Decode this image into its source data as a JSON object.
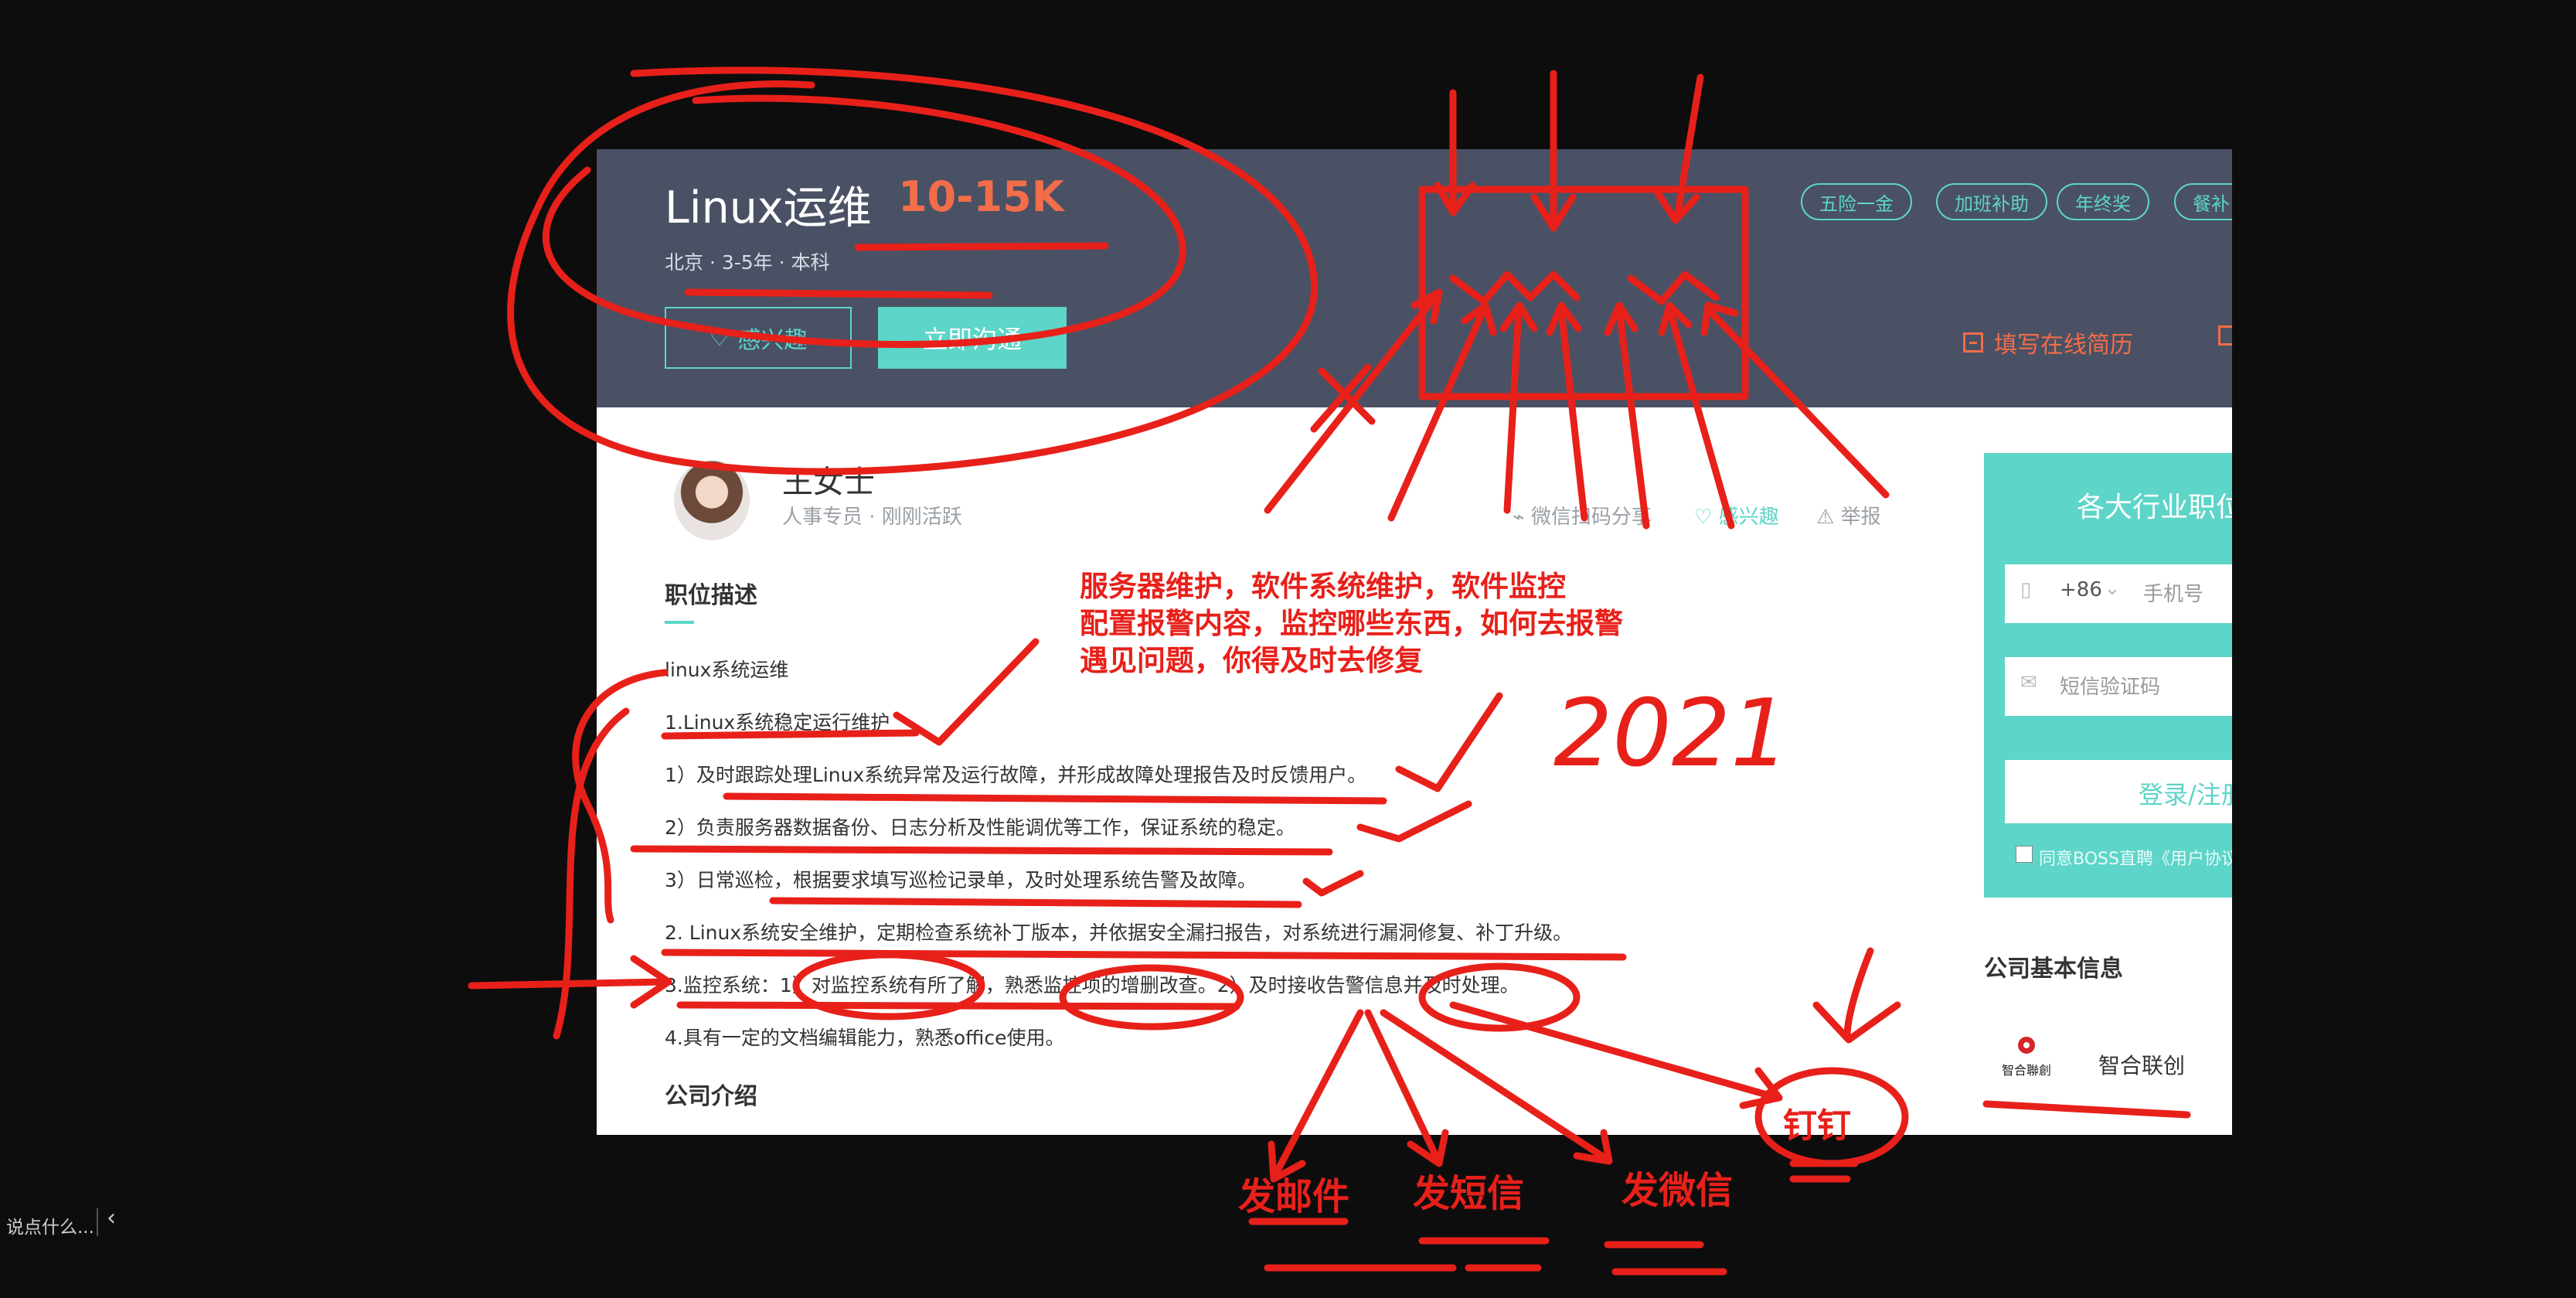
{
  "job": {
    "title": "Linux运维",
    "salary": "10-15K",
    "meta": "北京 · 3-5年 · 本科",
    "interest_label": "感兴趣",
    "chat_label": "立即沟通",
    "tags": [
      "五险一金",
      "加班补助",
      "年终奖",
      "餐补"
    ],
    "resume_link": "填写在线简历"
  },
  "recruiter": {
    "name": "王女士",
    "sub": "人事专员 ·  刚刚活跃",
    "actions": [
      "微信扫码分享",
      "感兴趣",
      "举报"
    ]
  },
  "description": {
    "heading": "职位描述",
    "lines": [
      "linux系统运维",
      "1.Linux系统稳定运行维护",
      "1）及时跟踪处理Linux系统异常及运行故障，并形成故障处理报告及时反馈用户。",
      "2）负责服务器数据备份、日志分析及性能调优等工作，保证系统的稳定。",
      "3）日常巡检，根据要求填写巡检记录单，及时处理系统告警及故障。",
      "2. Linux系统安全维护，定期检查系统补丁版本，并依据安全漏扫报告，对系统进行漏洞修复、补丁升级。",
      "3.监控系统：1）对监控系统有所了解，熟悉监控项的增删改查。2）及时接收告警信息并及时处理。",
      "4.具有一定的文档编辑能力，熟悉office使用。"
    ],
    "company_heading": "公司介绍"
  },
  "sidebar": {
    "title": "各大行业职位",
    "country_code": "+86",
    "phone_placeholder": "手机号",
    "sms_placeholder": "短信验证码",
    "login_label": "登录/注册",
    "agree_text": "同意BOSS直聘《用户协议》",
    "company_heading": "公司基本信息",
    "company_name": "智合联创",
    "company_logo_text": "智合聯創"
  },
  "annotations": {
    "note_lines": [
      "服务器维护，软件系统维护，软件监控",
      "配置报警内容，监控哪些东西，如何去报警",
      "遇见问题，你得及时去修复"
    ],
    "handwritten_number": "2021",
    "alert_channels": [
      "发邮件",
      "发短信",
      "发微信",
      "钉钉"
    ]
  },
  "chat": {
    "placeholder": "说点什么...",
    "collapse_glyph": "‹"
  },
  "colors": {
    "accent": "#5dd5c8",
    "salary": "#f26d49",
    "banner": "#4a5164",
    "annotation": "#e8201a"
  }
}
